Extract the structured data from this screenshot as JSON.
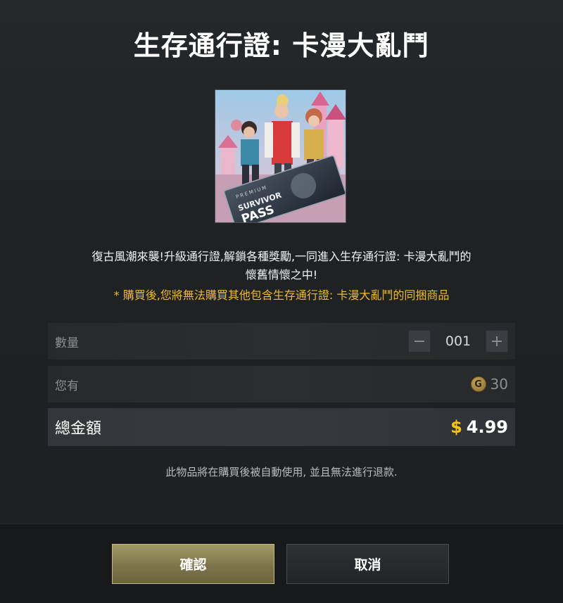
{
  "dialog": {
    "title": "生存通行證: 卡漫大亂鬥",
    "description_line1": "復古風潮來襲!升級通行證,解鎖各種獎勵,一同進入生存通行證: 卡漫大亂鬥的",
    "description_line2": "懷舊情懷之中!",
    "warning": "* 購買後,您將無法購買其他包含生存通行證: 卡漫大亂鬥的同捆商品",
    "note": "此物品將在購買後被自動使用, 並且無法進行退款."
  },
  "image": {
    "badge_line1": "PREMIUM",
    "badge_line2": "SURVIVOR",
    "badge_line3": "PASS"
  },
  "quantity": {
    "label": "數量",
    "value": "001",
    "minus_label": "−",
    "plus_label": "+"
  },
  "balance": {
    "label": "您有",
    "coin_symbol": "G",
    "value": "30"
  },
  "total": {
    "label": "總金額",
    "currency": "$",
    "amount": "4.99"
  },
  "buttons": {
    "confirm": "確認",
    "cancel": "取消"
  },
  "colors": {
    "warning": "#f0b92c",
    "price_currency": "#f5c518",
    "confirm_button": "#8b8254"
  }
}
